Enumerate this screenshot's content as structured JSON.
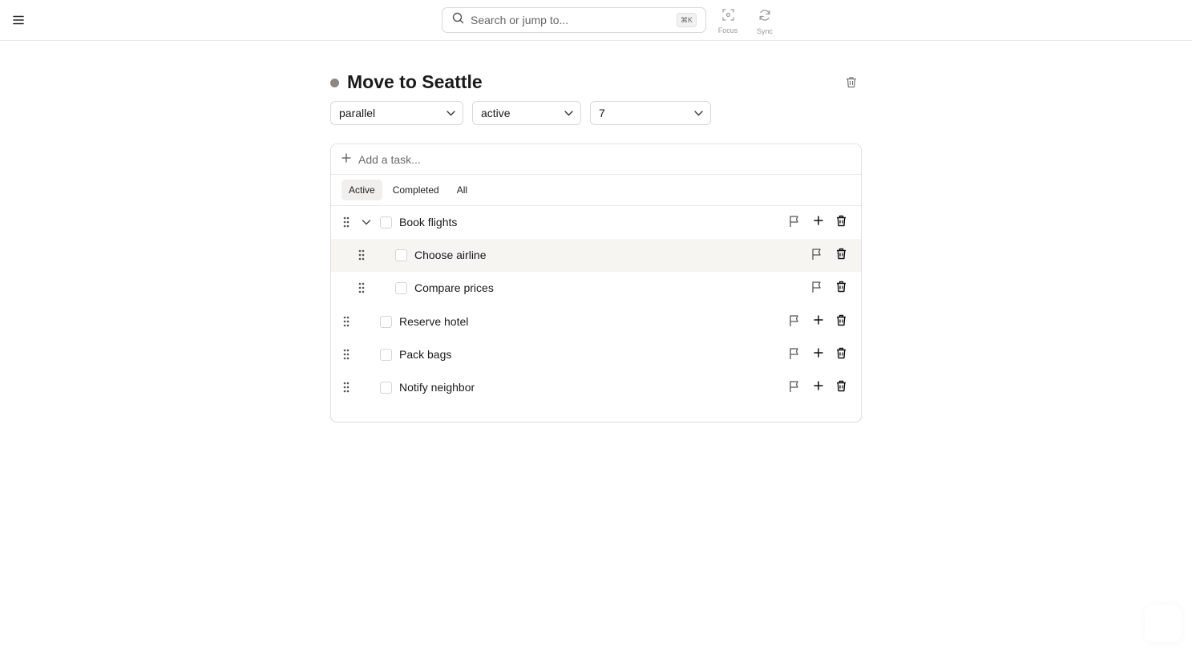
{
  "header": {
    "search_placeholder": "Search or jump to...",
    "search_shortcut": "⌘K",
    "tools": [
      {
        "label": "Focus",
        "icon": "focus-icon"
      },
      {
        "label": "Sync",
        "icon": "sync-icon"
      }
    ]
  },
  "project": {
    "title": "Move to Seattle",
    "dot_color": "#8e8680",
    "mode": "parallel",
    "status": "active",
    "number": "7"
  },
  "task_panel": {
    "add_placeholder": "Add a task...",
    "tabs": [
      "Active",
      "Completed",
      "All"
    ],
    "selected_tab": "Active",
    "tasks": [
      {
        "name": "Book flights",
        "level": 0,
        "expanded": true
      },
      {
        "name": "Choose airline",
        "level": 1,
        "highlighted": true
      },
      {
        "name": "Compare prices",
        "level": 1
      },
      {
        "name": "Reserve hotel",
        "level": 0
      },
      {
        "name": "Pack bags",
        "level": 0
      },
      {
        "name": "Notify neighbor",
        "level": 0
      }
    ]
  },
  "colors": {
    "highlight_row": "#f7f5f2",
    "active_tab": "#f0efed",
    "border": "#dedede"
  }
}
